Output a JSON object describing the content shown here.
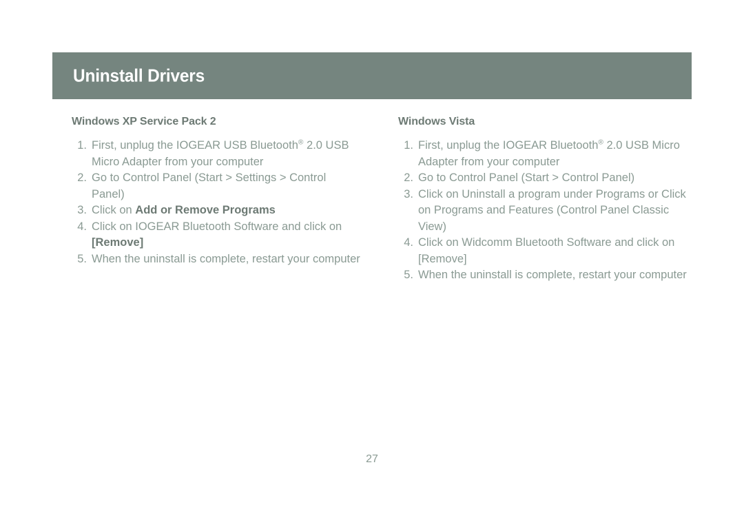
{
  "colors": {
    "banner_bg": "#75857f",
    "banner_text": "#ffffff",
    "heading_text": "#6d7a74",
    "body_text": "#8a9a93",
    "page_bg": "#ffffff"
  },
  "header": {
    "title": "Uninstall Drivers"
  },
  "columns": {
    "left": {
      "heading": "Windows XP Service Pack 2",
      "steps": [
        {
          "number": "1.",
          "parts": [
            {
              "text": "First, unplug the IOGEAR USB Bluetooth",
              "bold": false
            },
            {
              "text": "®",
              "bold": false,
              "sup": true
            },
            {
              "text": " 2.0 USB Micro Adapter from your computer",
              "bold": false
            }
          ]
        },
        {
          "number": "2.",
          "parts": [
            {
              "text": "Go to Control Panel (Start > Settings > Control Panel)",
              "bold": false
            }
          ]
        },
        {
          "number": "3.",
          "parts": [
            {
              "text": "Click on ",
              "bold": false
            },
            {
              "text": "Add or Remove Programs",
              "bold": true
            }
          ]
        },
        {
          "number": "4.",
          "parts": [
            {
              "text": "Click on IOGEAR Bluetooth Software and click on ",
              "bold": false
            },
            {
              "text": "[Remove]",
              "bold": true
            }
          ]
        },
        {
          "number": "5.",
          "parts": [
            {
              "text": "When the uninstall is complete, restart your computer",
              "bold": false
            }
          ]
        }
      ]
    },
    "right": {
      "heading": "Windows Vista",
      "steps": [
        {
          "number": "1.",
          "parts": [
            {
              "text": "First, unplug the IOGEAR Bluetooth",
              "bold": false
            },
            {
              "text": "®",
              "bold": false,
              "sup": true
            },
            {
              "text": " 2.0 USB Micro Adapter from your computer",
              "bold": false
            }
          ]
        },
        {
          "number": "2.",
          "parts": [
            {
              "text": "Go to Control Panel (Start > Control Panel)",
              "bold": false
            }
          ]
        },
        {
          "number": "3.",
          "parts": [
            {
              "text": "Click on Uninstall a program under Programs or Click on Programs and Features (Control Panel Classic View)",
              "bold": false
            }
          ]
        },
        {
          "number": "4.",
          "parts": [
            {
              "text": "Click on Widcomm Bluetooth Software and click on [Remove]",
              "bold": false
            }
          ]
        },
        {
          "number": "5.",
          "parts": [
            {
              "text": "When the uninstall is complete, restart your computer",
              "bold": false
            }
          ]
        }
      ]
    }
  },
  "footer": {
    "page_number": "27"
  }
}
